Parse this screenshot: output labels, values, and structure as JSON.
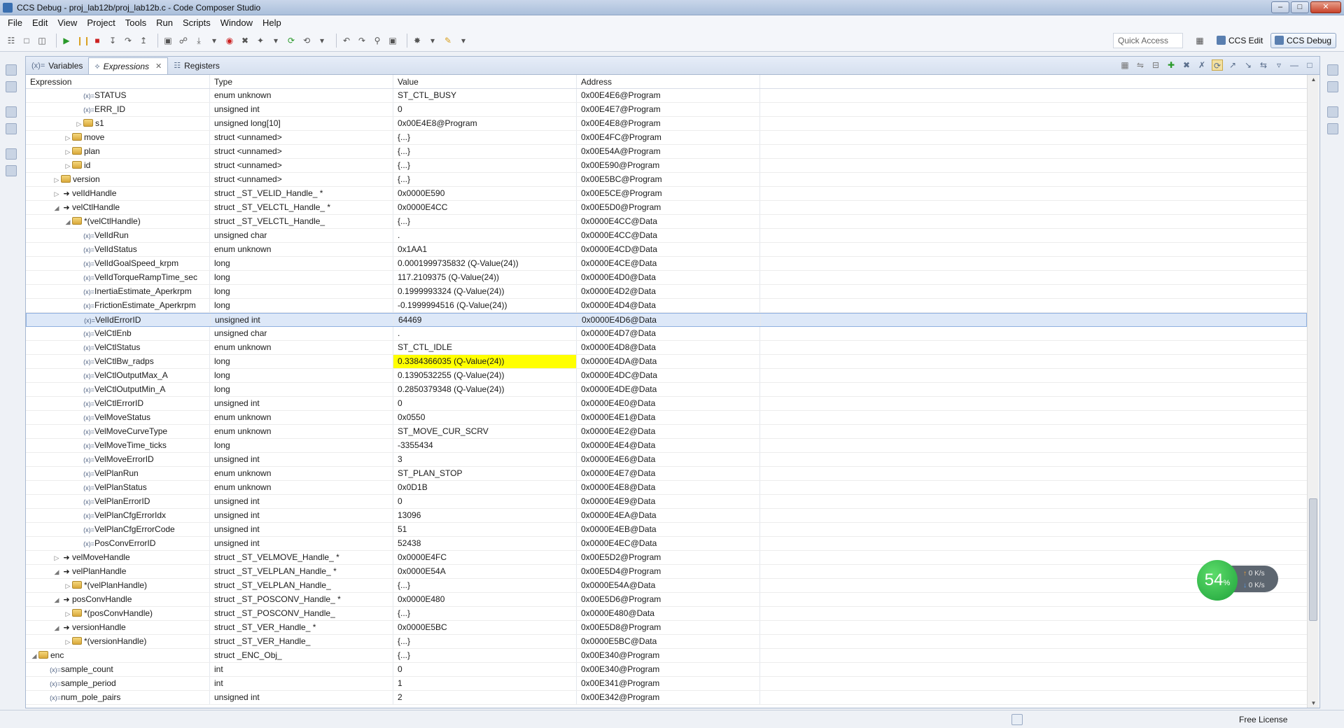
{
  "window": {
    "title": "CCS Debug - proj_lab12b/proj_lab12b.c - Code Composer Studio",
    "min_label": "–",
    "max_label": "□",
    "close_label": "✕"
  },
  "menu": [
    "File",
    "Edit",
    "View",
    "Project",
    "Tools",
    "Run",
    "Scripts",
    "Window",
    "Help"
  ],
  "toolbar": {
    "quick_access": "Quick Access",
    "perspective_edit": "CCS Edit",
    "perspective_debug": "CCS Debug"
  },
  "tabs": [
    {
      "label": "Variables",
      "icon": "(x)="
    },
    {
      "label": "Expressions",
      "icon": "⟡"
    },
    {
      "label": "Registers",
      "icon": "☷"
    }
  ],
  "columns": [
    "Expression",
    "Type",
    "Value",
    "Address"
  ],
  "rows": [
    {
      "indent": 4,
      "twisty": "",
      "icon": "var",
      "name": "STATUS",
      "type": "enum unknown",
      "value": "ST_CTL_BUSY",
      "address": "0x00E4E6@Program"
    },
    {
      "indent": 4,
      "twisty": "",
      "icon": "var",
      "name": "ERR_ID",
      "type": "unsigned int",
      "value": "0",
      "address": "0x00E4E7@Program"
    },
    {
      "indent": 4,
      "twisty": "▷",
      "icon": "folder",
      "name": "s1",
      "type": "unsigned long[10]",
      "value": "0x00E4E8@Program",
      "address": "0x00E4E8@Program"
    },
    {
      "indent": 3,
      "twisty": "▷",
      "icon": "folder",
      "name": "move",
      "type": "struct <unnamed>",
      "value": "{...}",
      "address": "0x00E4FC@Program"
    },
    {
      "indent": 3,
      "twisty": "▷",
      "icon": "folder",
      "name": "plan",
      "type": "struct <unnamed>",
      "value": "{...}",
      "address": "0x00E54A@Program"
    },
    {
      "indent": 3,
      "twisty": "▷",
      "icon": "folder",
      "name": "id",
      "type": "struct <unnamed>",
      "value": "{...}",
      "address": "0x00E590@Program"
    },
    {
      "indent": 2,
      "twisty": "▷",
      "icon": "folder",
      "name": "version",
      "type": "struct <unnamed>",
      "value": "{...}",
      "address": "0x00E5BC@Program"
    },
    {
      "indent": 2,
      "twisty": "▷",
      "icon": "arrow",
      "name": "velIdHandle",
      "type": "struct _ST_VELID_Handle_ *",
      "value": "0x0000E590",
      "address": "0x00E5CE@Program"
    },
    {
      "indent": 2,
      "twisty": "◢",
      "icon": "arrow",
      "name": "velCtlHandle",
      "type": "struct _ST_VELCTL_Handle_ *",
      "value": "0x0000E4CC",
      "address": "0x00E5D0@Program"
    },
    {
      "indent": 3,
      "twisty": "◢",
      "icon": "folder",
      "name": "*(velCtlHandle)",
      "type": "struct _ST_VELCTL_Handle_",
      "value": "{...}",
      "address": "0x0000E4CC@Data"
    },
    {
      "indent": 4,
      "twisty": "",
      "icon": "var",
      "name": "VelIdRun",
      "type": "unsigned char",
      "value": ".",
      "address": "0x0000E4CC@Data"
    },
    {
      "indent": 4,
      "twisty": "",
      "icon": "var",
      "name": "VelIdStatus",
      "type": "enum unknown",
      "value": "0x1AA1",
      "address": "0x0000E4CD@Data"
    },
    {
      "indent": 4,
      "twisty": "",
      "icon": "var",
      "name": "VelIdGoalSpeed_krpm",
      "type": "long",
      "value": "0.0001999735832 (Q-Value(24))",
      "address": "0x0000E4CE@Data"
    },
    {
      "indent": 4,
      "twisty": "",
      "icon": "var",
      "name": "VelIdTorqueRampTime_sec",
      "type": "long",
      "value": "117.2109375 (Q-Value(24))",
      "address": "0x0000E4D0@Data"
    },
    {
      "indent": 4,
      "twisty": "",
      "icon": "var",
      "name": "InertiaEstimate_Aperkrpm",
      "type": "long",
      "value": "0.1999993324 (Q-Value(24))",
      "address": "0x0000E4D2@Data"
    },
    {
      "indent": 4,
      "twisty": "",
      "icon": "var",
      "name": "FrictionEstimate_Aperkrpm",
      "type": "long",
      "value": "-0.1999994516 (Q-Value(24))",
      "address": "0x0000E4D4@Data"
    },
    {
      "indent": 4,
      "twisty": "",
      "icon": "var",
      "name": "VelIdErrorID",
      "type": "unsigned int",
      "value": "64469",
      "address": "0x0000E4D6@Data",
      "selected": true
    },
    {
      "indent": 4,
      "twisty": "",
      "icon": "var",
      "name": "VelCtlEnb",
      "type": "unsigned char",
      "value": ".",
      "address": "0x0000E4D7@Data"
    },
    {
      "indent": 4,
      "twisty": "",
      "icon": "var",
      "name": "VelCtlStatus",
      "type": "enum unknown",
      "value": "ST_CTL_IDLE",
      "address": "0x0000E4D8@Data"
    },
    {
      "indent": 4,
      "twisty": "",
      "icon": "var",
      "name": "VelCtlBw_radps",
      "type": "long",
      "value": "0.3384366035 (Q-Value(24))",
      "address": "0x0000E4DA@Data",
      "highlight": true
    },
    {
      "indent": 4,
      "twisty": "",
      "icon": "var",
      "name": "VelCtlOutputMax_A",
      "type": "long",
      "value": "0.1390532255 (Q-Value(24))",
      "address": "0x0000E4DC@Data"
    },
    {
      "indent": 4,
      "twisty": "",
      "icon": "var",
      "name": "VelCtlOutputMin_A",
      "type": "long",
      "value": "0.2850379348 (Q-Value(24))",
      "address": "0x0000E4DE@Data"
    },
    {
      "indent": 4,
      "twisty": "",
      "icon": "var",
      "name": "VelCtlErrorID",
      "type": "unsigned int",
      "value": "0",
      "address": "0x0000E4E0@Data"
    },
    {
      "indent": 4,
      "twisty": "",
      "icon": "var",
      "name": "VelMoveStatus",
      "type": "enum unknown",
      "value": "0x0550",
      "address": "0x0000E4E1@Data"
    },
    {
      "indent": 4,
      "twisty": "",
      "icon": "var",
      "name": "VelMoveCurveType",
      "type": "enum unknown",
      "value": "ST_MOVE_CUR_SCRV",
      "address": "0x0000E4E2@Data"
    },
    {
      "indent": 4,
      "twisty": "",
      "icon": "var",
      "name": "VelMoveTime_ticks",
      "type": "long",
      "value": "-3355434",
      "address": "0x0000E4E4@Data"
    },
    {
      "indent": 4,
      "twisty": "",
      "icon": "var",
      "name": "VelMoveErrorID",
      "type": "unsigned int",
      "value": "3",
      "address": "0x0000E4E6@Data"
    },
    {
      "indent": 4,
      "twisty": "",
      "icon": "var",
      "name": "VelPlanRun",
      "type": "enum unknown",
      "value": "ST_PLAN_STOP",
      "address": "0x0000E4E7@Data"
    },
    {
      "indent": 4,
      "twisty": "",
      "icon": "var",
      "name": "VelPlanStatus",
      "type": "enum unknown",
      "value": "0x0D1B",
      "address": "0x0000E4E8@Data"
    },
    {
      "indent": 4,
      "twisty": "",
      "icon": "var",
      "name": "VelPlanErrorID",
      "type": "unsigned int",
      "value": "0",
      "address": "0x0000E4E9@Data"
    },
    {
      "indent": 4,
      "twisty": "",
      "icon": "var",
      "name": "VelPlanCfgErrorIdx",
      "type": "unsigned int",
      "value": "13096",
      "address": "0x0000E4EA@Data"
    },
    {
      "indent": 4,
      "twisty": "",
      "icon": "var",
      "name": "VelPlanCfgErrorCode",
      "type": "unsigned int",
      "value": "51",
      "address": "0x0000E4EB@Data"
    },
    {
      "indent": 4,
      "twisty": "",
      "icon": "var",
      "name": "PosConvErrorID",
      "type": "unsigned int",
      "value": "52438",
      "address": "0x0000E4EC@Data"
    },
    {
      "indent": 2,
      "twisty": "▷",
      "icon": "arrow",
      "name": "velMoveHandle",
      "type": "struct _ST_VELMOVE_Handle_ *",
      "value": "0x0000E4FC",
      "address": "0x00E5D2@Program"
    },
    {
      "indent": 2,
      "twisty": "◢",
      "icon": "arrow",
      "name": "velPlanHandle",
      "type": "struct _ST_VELPLAN_Handle_ *",
      "value": "0x0000E54A",
      "address": "0x00E5D4@Program"
    },
    {
      "indent": 3,
      "twisty": "▷",
      "icon": "folder",
      "name": "*(velPlanHandle)",
      "type": "struct _ST_VELPLAN_Handle_",
      "value": "{...}",
      "address": "0x0000E54A@Data"
    },
    {
      "indent": 2,
      "twisty": "◢",
      "icon": "arrow",
      "name": "posConvHandle",
      "type": "struct _ST_POSCONV_Handle_ *",
      "value": "0x0000E480",
      "address": "0x00E5D6@Program"
    },
    {
      "indent": 3,
      "twisty": "▷",
      "icon": "folder",
      "name": "*(posConvHandle)",
      "type": "struct _ST_POSCONV_Handle_",
      "value": "{...}",
      "address": "0x0000E480@Data"
    },
    {
      "indent": 2,
      "twisty": "◢",
      "icon": "arrow",
      "name": "versionHandle",
      "type": "struct _ST_VER_Handle_ *",
      "value": "0x0000E5BC",
      "address": "0x00E5D8@Program"
    },
    {
      "indent": 3,
      "twisty": "▷",
      "icon": "folder",
      "name": "*(versionHandle)",
      "type": "struct _ST_VER_Handle_",
      "value": "{...}",
      "address": "0x0000E5BC@Data"
    },
    {
      "indent": 0,
      "twisty": "◢",
      "icon": "folder",
      "name": "enc",
      "type": "struct _ENC_Obj_",
      "value": "{...}",
      "address": "0x00E340@Program"
    },
    {
      "indent": 1,
      "twisty": "",
      "icon": "var",
      "name": "sample_count",
      "type": "int",
      "value": "0",
      "address": "0x00E340@Program"
    },
    {
      "indent": 1,
      "twisty": "",
      "icon": "var",
      "name": "sample_period",
      "type": "int",
      "value": "1",
      "address": "0x00E341@Program"
    },
    {
      "indent": 1,
      "twisty": "",
      "icon": "var",
      "name": "num_pole_pairs",
      "type": "unsigned int",
      "value": "2",
      "address": "0x00E342@Program"
    }
  ],
  "status": {
    "license": "Free License"
  },
  "net_widget": {
    "percent": "54",
    "percent_sign": "%",
    "up_rate": "0",
    "down_rate": "0",
    "unit": "K/s"
  },
  "colors": {
    "highlight": "#ffff00",
    "selection": "#dde8f8",
    "accent": "#3a6fb0"
  }
}
